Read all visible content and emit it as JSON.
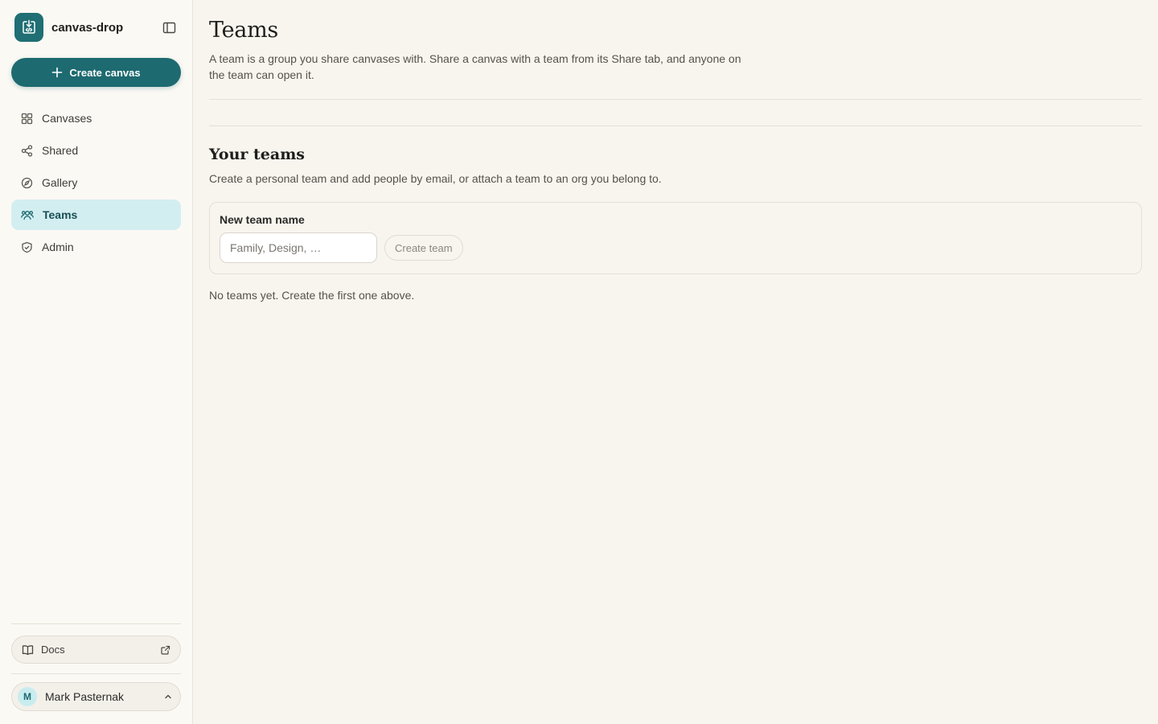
{
  "app": {
    "name": "canvas-drop",
    "create_label": "Create canvas"
  },
  "sidebar": {
    "items": [
      {
        "label": "Canvases",
        "icon": "grid-icon"
      },
      {
        "label": "Shared",
        "icon": "share-icon"
      },
      {
        "label": "Gallery",
        "icon": "compass-icon"
      },
      {
        "label": "Teams",
        "icon": "users-icon",
        "active": true
      },
      {
        "label": "Admin",
        "icon": "shield-icon"
      }
    ],
    "docs_label": "Docs",
    "user": {
      "initial": "M",
      "name": "Mark Pasternak"
    }
  },
  "page": {
    "title": "Teams",
    "description": "A team is a group you share canvases with. Share a canvas with a team from its Share tab, and anyone on the team can open it."
  },
  "your_teams": {
    "title": "Your teams",
    "description": "Create a personal team and add people by email, or attach a team to an org you belong to.",
    "field_label": "New team name",
    "input_placeholder": "Family, Design, …",
    "input_value": "",
    "create_label": "Create team",
    "empty_message": "No teams yet. Create the first one above."
  },
  "colors": {
    "accent": "#1d6a70",
    "active_bg": "#d3eef1",
    "background": "#f8f5ef"
  }
}
